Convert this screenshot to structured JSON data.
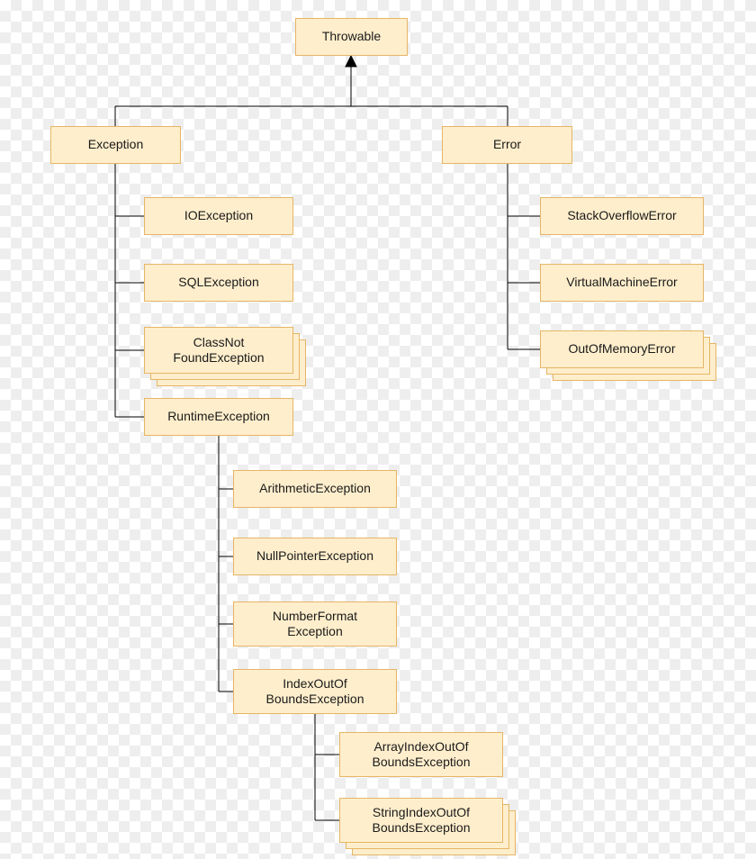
{
  "colors": {
    "node_fill": "#ffeecc",
    "node_border": "#e6b566",
    "connector": "#000000"
  },
  "root": {
    "label": "Throwable"
  },
  "branches": {
    "exception": {
      "label": "Exception",
      "children": [
        {
          "id": "ioexception",
          "label": "IOException",
          "stacked": false
        },
        {
          "id": "sqlexception",
          "label": "SQLException",
          "stacked": false
        },
        {
          "id": "classnotfound",
          "label": "ClassNot\nFoundException",
          "stacked": true
        },
        {
          "id": "runtime",
          "label": "RuntimeException",
          "stacked": false,
          "children": [
            {
              "id": "arithmetic",
              "label": "ArithmeticException",
              "stacked": false
            },
            {
              "id": "nullpointer",
              "label": "NullPointerException",
              "stacked": false
            },
            {
              "id": "numberformat",
              "label": "NumberFormat\nException",
              "stacked": false
            },
            {
              "id": "indexoob",
              "label": "IndexOutOf\nBoundsException",
              "stacked": false,
              "children": [
                {
                  "id": "arrayindex",
                  "label": "ArrayIndexOutOf\nBoundsException",
                  "stacked": false
                },
                {
                  "id": "stringindex",
                  "label": "StringIndexOutOf\nBoundsException",
                  "stacked": true
                }
              ]
            }
          ]
        }
      ]
    },
    "error": {
      "label": "Error",
      "children": [
        {
          "id": "stackoverflow",
          "label": "StackOverflowError",
          "stacked": false
        },
        {
          "id": "virtualmachine",
          "label": "VirtualMachineError",
          "stacked": false
        },
        {
          "id": "outofmemory",
          "label": "OutOfMemoryError",
          "stacked": true
        }
      ]
    }
  }
}
